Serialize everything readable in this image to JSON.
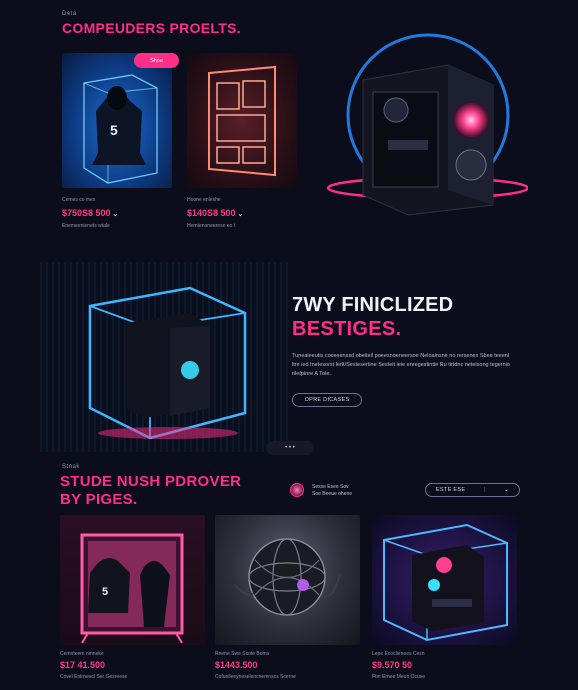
{
  "colors": {
    "accent": "#ff2e88",
    "background": "#0b0e1a",
    "neon_blue": "#2aa8ff"
  },
  "section1": {
    "eyebrow": "Deta",
    "title": "COMPEUDERS PROELTS.",
    "badge": "Shoe",
    "products": [
      {
        "caption_top": "Cemes co mes",
        "price": "$750S8 500",
        "caption_bottom": "Enemeenienets wtale",
        "icon": "hoodie-in-neon-cube"
      },
      {
        "caption_top": "Hoone enleshe",
        "price": "$140S8 500",
        "caption_bottom": "Hemtenoneerese eo t",
        "icon": "neon-frame"
      }
    ],
    "hero_icon": "pc-case-neon-ring"
  },
  "section2": {
    "title_line1": "7WY FINICLIZED",
    "title_line2": "BESTIGES.",
    "body": "Tuneaieeutis coceeenssd obeiteil poeesnoeneersoe Neloainsne no rersenes Sbee teeenl ltre ied tnetesorst lerlt/Sestesertine Sesteit ieie enregestintie Ru tirtdnc neteisong tegernio riletpinre A Tote.",
    "cta": "OPRE DICASES",
    "pager": "• • •"
  },
  "section3": {
    "eyebrow": "Stnak",
    "title_line1": "STUDE NUSH PDROVER",
    "title_line2": "BY PIGES.",
    "user_line1": "Sesse Esee Sov",
    "user_line2": "Soe Beeue ohene",
    "filter_label": "ESTE ESE",
    "filter_icon": "chevron-down-icon",
    "products": [
      {
        "caption_top": "Cemnteem nmneke",
        "price": "$17 41.500",
        "caption_bottom": "Covel Estrneecl Ser Gesreese"
      },
      {
        "caption_top": "Rnene Swe Scote Boms",
        "price": "$1443.500",
        "caption_bottom": "Cofuelleeyneselencnemnscs Scerne"
      },
      {
        "caption_top": "Lepe Ecoclienees Cesn",
        "price": "$9.570 50",
        "caption_bottom": "Ftet Ernee Meon Ocuse"
      }
    ]
  }
}
